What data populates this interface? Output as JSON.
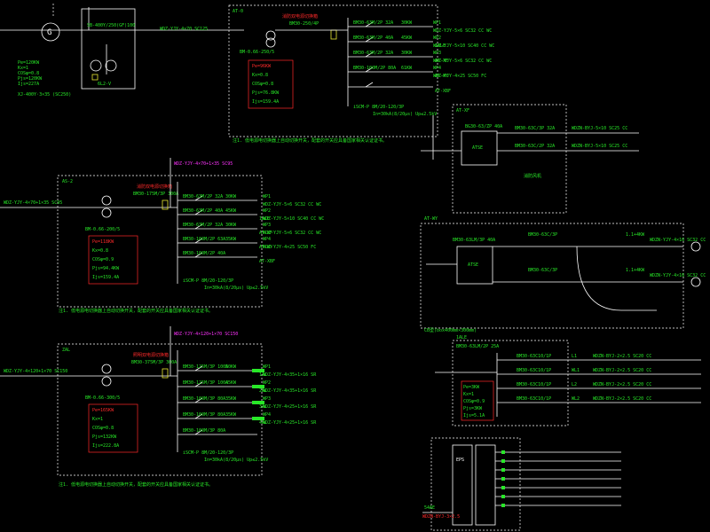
{
  "colors": {
    "background": "#000000",
    "line": "#ffffff",
    "text": "#28e828",
    "title": "#ff2a2a",
    "accent": "#ffff33",
    "magenta": "#ff33ff"
  },
  "generator": {
    "model": "SB-400Y/250(GF)100",
    "params": [
      "Pe=120KW",
      "Kx=1",
      "COSφ=0.8",
      "Pjs=120KW",
      "Ijs=227A"
    ],
    "bottom": "XJ-400Y·3×35 (SC250)",
    "meter": "6L2-V"
  },
  "at0": {
    "label": "AT-0",
    "cable_in": "WDZ-YJY-4×70 SC125",
    "breaker_main": "BM-0.66-250/5",
    "title": "消防双电源切换箱",
    "main_breaker": "BM30-250/4P",
    "params": [
      "Pe=96KW",
      "Kx=0.8",
      "COSφ=0.8",
      "Pjs=76.8KW",
      "Ijs=159.4A"
    ],
    "rows": [
      {
        "cb": "BM30-63M/2P 32A",
        "id": "WP1",
        "cable": "WDZ-YJY-5×6 SC32 CC WC",
        "load": "30KW"
      },
      {
        "cb": "BM30-63M/2P 40A",
        "id": "WP2",
        "cable": "WDZ-YJY-5×10 SC40 CC WC",
        "load": "45KW",
        "dest": "1ALE"
      },
      {
        "cb": "BM30-63M/2P 32A",
        "id": "WP3",
        "cable": "WDZ-YJY-5×6 SC32 CC WC",
        "load": "30KW",
        "dest": "AT-XF"
      },
      {
        "cb": "BM30-100M/2P 80A",
        "id": "WP4",
        "cable": "WDZ-YJY-4×25 SC50 FC",
        "load": "61KW",
        "dest": "AT-WY"
      },
      {
        "cb": "",
        "id": "",
        "cable": "",
        "load": "",
        "dest": "AT-XBF"
      }
    ],
    "spd": "iSCM-P 8M/20-120/3P",
    "spd_spec": "In=30kA(8/20μs) Up≤2.5kV",
    "note": "注1. 低电源电切换器上自动切换开关，配套的开关应具备国家相关认证证书。"
  },
  "as2": {
    "label": "AS-2",
    "cable_in": "WDZ-YJY-4×70+1×35 SC95",
    "breaker_main": "BM-0.66-200/5",
    "title": "消防双电源切换箱",
    "main_breaker": "BM30-175M/3P 300A",
    "params": [
      "Pe=118KW",
      "Kx=0.8",
      "COSφ=0.9",
      "Pjs=94.4KW",
      "Ijs=159.4A"
    ],
    "rows": [
      {
        "cb": "BM30-63M/2P 32A",
        "id": "WP1",
        "cable": "WDZ-YJY-5×6 SC32 CC WC",
        "load": "30KW"
      },
      {
        "cb": "BM30-63M/2P 40A",
        "id": "WP2",
        "cable": "WDZ-YJY-5×10 SC40 CC WC",
        "load": "45KW",
        "dest": "1ALE"
      },
      {
        "cb": "BM30-63M/2P 32A",
        "id": "WP3",
        "cable": "WDZ-YJY-5×6 SC32 CC WC",
        "load": "30KW",
        "dest": "AT-XF"
      },
      {
        "cb": "BM30-100M/2P 63A",
        "id": "WP4",
        "cable": "WDZ-YJY-4×25 SC50 FC",
        "load": "35KW",
        "dest": "AT-WY"
      },
      {
        "cb": "BM30-100M/2P 40A",
        "id": "",
        "cable": "",
        "load": "",
        "dest": "AT-XBF"
      }
    ],
    "spd": "iSCM-P 8M/20-120/3P",
    "spd_spec": "In=30kA(8/20μs) Up≤2.5kV",
    "note": "注1. 低电源电切换器上自动切换开关，配套的开关应具备国家相关认证证书。"
  },
  "zal": {
    "label": "ZAL",
    "cable_in": "WDZ-YJY-4×120+1×70 SC150",
    "breaker_main": "BM-0.66-300/5",
    "title": "照明双电源切换箱",
    "main_breaker": "BM30-375M/3P 300A",
    "params": [
      "Pe=165KW",
      "Kx=1",
      "COSφ=0.8",
      "Pjs=132KW",
      "Ijs=222.8A"
    ],
    "rows": [
      {
        "cb": "BM30-125M/3P 100A",
        "id": "WP1",
        "cable": "WDZ-YJY-4×35+1×16 SR",
        "load": "50KW",
        "dest": "1AL"
      },
      {
        "cb": "BM30-125M/3P 100A",
        "id": "WP2",
        "cable": "WDZ-YJY-4×35+1×16 SR",
        "load": "45KW",
        "dest": "2AL"
      },
      {
        "cb": "BM30-100M/3P 80A",
        "id": "WP3",
        "cable": "WDZ-YJY-4×25+1×16 SR",
        "load": "35KW",
        "dest": "3AL"
      },
      {
        "cb": "BM30-100M/3P 80A",
        "id": "WP4",
        "cable": "WDZ-YJY-4×25+1×16 SR",
        "load": "35KW",
        "dest": "4AL"
      },
      {
        "cb": "BM30-100M/3P 80A",
        "id": "",
        "cable": "",
        "load": "",
        "dest": ""
      }
    ],
    "spd": "iSCM-P 8M/20-120/3P",
    "spd_spec": "In=30kA(8/20μs) Up≤2.5kV",
    "note": "注1. 低电源电切换器上自动切换开关，配套的开关应具备国家相关认证证书。"
  },
  "xf": {
    "label": "AT-XF",
    "breaker": "BG30-63/ZP 40A",
    "ats": "ATSE",
    "outs": [
      "BM30-63C/3P 32A",
      "BM30-63C/2P 32A"
    ],
    "cables": [
      "WDZN-BYJ-5×10 SC25 CC",
      "WDZN-BYJ-5×10 SC25 CC"
    ],
    "note": "消防风机"
  },
  "wy": {
    "label": "AT-WY",
    "breaker": "BM30-63LM/3P 40A",
    "ats": "ATSE",
    "outs": [
      "BM30-63C/3P",
      "BM30-63C/3P"
    ],
    "cables": [
      "WDZN-YJY-4×16 SC32 CC",
      "WDZN-YJY-4×16 SC32 CC"
    ],
    "loads": [
      "1.1+4KW",
      "1.1+4KW"
    ],
    "note": "CB型(box400mm×300mm)"
  },
  "ale": {
    "label": "1ALE",
    "breaker": "BM30-63LM/2P 25A",
    "outs": [
      "BM30-63C10/1P",
      "BM30-63C10/1P",
      "BM30-63C10/1P",
      "BM30-63C10/1P"
    ],
    "ids": [
      "L1",
      "WL1",
      "L2",
      "WL2"
    ],
    "cables": [
      "WDZN-BYJ-2×2.5 SC20 CC",
      "WDZN-BYJ-2×2.5 SC20 CC",
      "WDZN-BYJ-2×2.5 SC20 CC",
      "WDZN-BYJ-2×2.5 SC20 CC"
    ],
    "params": [
      "Pe=3KW",
      "Kx=1",
      "COSφ=0.9",
      "Pjs=3KW",
      "Ijs=5.1A"
    ]
  },
  "ep": {
    "label": "EPS",
    "sub": "54AE",
    "cable": "WDZN-BYJ-3×2.5",
    "rows": 7
  }
}
